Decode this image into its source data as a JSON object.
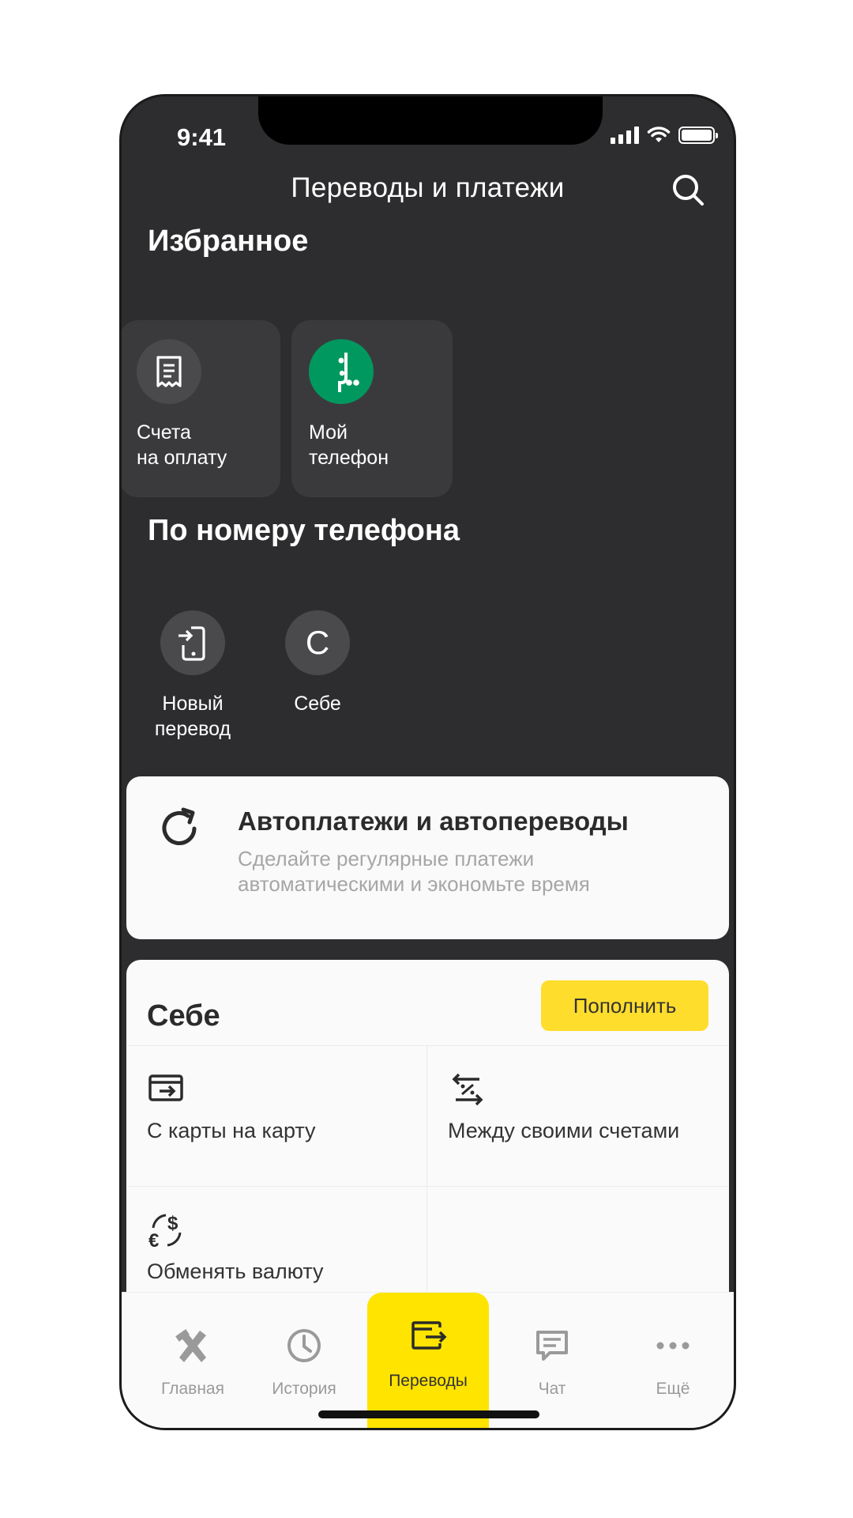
{
  "status_bar": {
    "time": "9:41"
  },
  "header": {
    "title": "Переводы и платежи",
    "search_icon": "search-icon"
  },
  "favorites": {
    "title": "Избранное",
    "items": [
      {
        "label": "Счета\nна оплату",
        "icon": "receipt-icon",
        "icon_bg": "#4a4a4d"
      },
      {
        "label": "Мой\nтелефон",
        "icon": "megafon-logo-icon",
        "icon_bg": "#00985f"
      }
    ]
  },
  "by_phone": {
    "title": "По номеру телефона",
    "items": [
      {
        "label": "Новый\nперевод",
        "icon": "phone-transfer-icon"
      },
      {
        "label": "Себе",
        "avatar_letter": "С"
      }
    ]
  },
  "autopay": {
    "title": "Автоплатежи и автопереводы",
    "subtitle": "Сделайте регулярные платежи автоматическими и экономьте время",
    "icon": "refresh-icon"
  },
  "self_transfers": {
    "title": "Себе",
    "topup_label": "Пополнить",
    "topup_color": "#ffdd2d",
    "items": [
      {
        "label": "С карты на карту",
        "icon": "card-to-card-icon"
      },
      {
        "label": "Между своими счетами",
        "icon": "between-accounts-icon"
      },
      {
        "label": "Обменять валюту",
        "icon": "currency-exchange-icon"
      }
    ]
  },
  "tabbar": {
    "active_color": "#ffe400",
    "items": [
      {
        "label": "Главная",
        "icon": "home-icon",
        "active": false
      },
      {
        "label": "История",
        "icon": "clock-icon",
        "active": false
      },
      {
        "label": "Переводы",
        "icon": "transfers-icon",
        "active": true
      },
      {
        "label": "Чат",
        "icon": "chat-icon",
        "active": false
      },
      {
        "label": "Ещё",
        "icon": "more-icon",
        "active": false
      }
    ]
  }
}
